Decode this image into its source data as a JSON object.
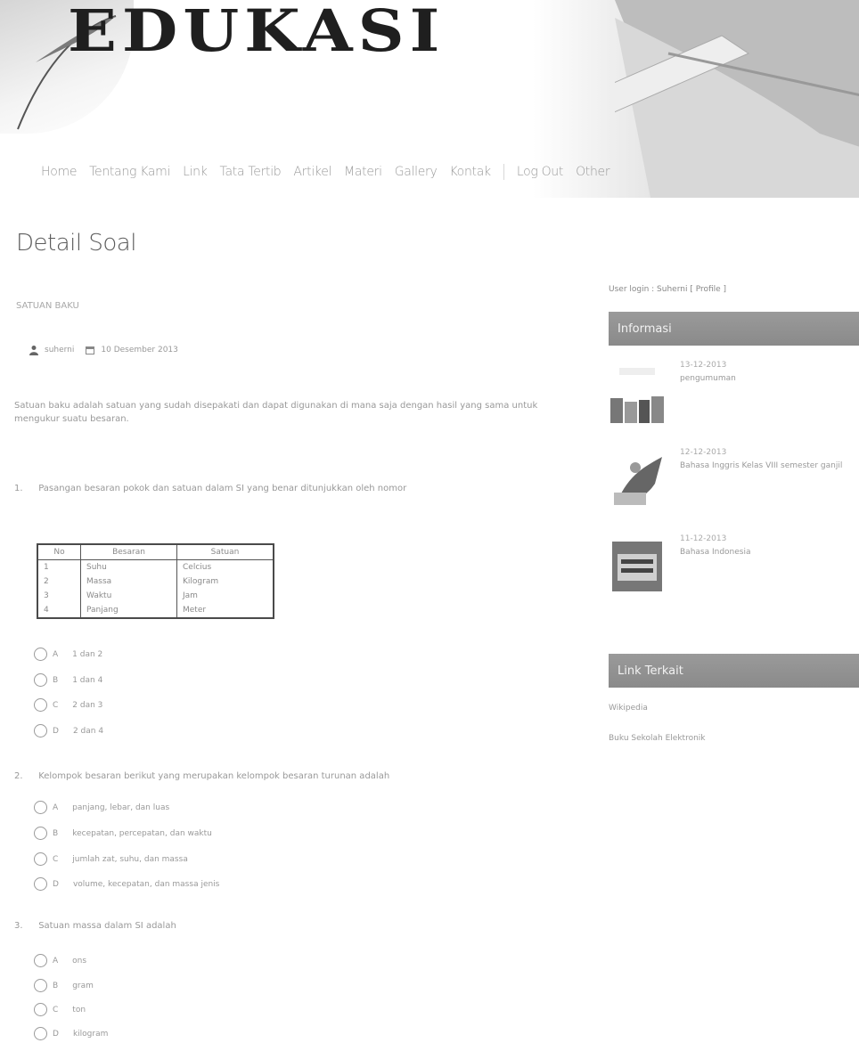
{
  "site": {
    "logo_text": "EDUKASI"
  },
  "nav": [
    "Home",
    "Tentang Kami",
    "Link",
    "Tata Tertib",
    "Artikel",
    "Materi",
    "Gallery",
    "Kontak",
    "Log Out",
    "Other"
  ],
  "page": {
    "title": "Detail Soal",
    "subtitle": "SATUAN BAKU",
    "author": "suherni",
    "date": "10 Desember 2013",
    "description": "Satuan baku adalah satuan yang sudah disepakati dan dapat digunakan di mana saja dengan hasil yang sama untuk mengukur suatu besaran."
  },
  "questions": [
    {
      "number": "1.",
      "text": "Pasangan besaran pokok dan satuan dalam SI yang benar ditunjukkan oleh nomor",
      "table": {
        "headers": [
          "No",
          "Besaran",
          "Satuan"
        ],
        "rows": [
          [
            "1",
            "Suhu",
            "Celcius"
          ],
          [
            "2",
            "Massa",
            "Kilogram"
          ],
          [
            "3",
            "Waktu",
            "Jam"
          ],
          [
            "4",
            "Panjang",
            "Meter"
          ]
        ]
      },
      "options": [
        {
          "label": "A",
          "text": "1 dan 2"
        },
        {
          "label": "B",
          "text": "1 dan 4"
        },
        {
          "label": "C",
          "text": "2 dan 3"
        },
        {
          "label": "D",
          "text": "2 dan 4"
        }
      ]
    },
    {
      "number": "2.",
      "text": "Kelompok besaran berikut yang merupakan kelompok besaran turunan adalah",
      "options": [
        {
          "label": "A",
          "text": "panjang, lebar, dan luas"
        },
        {
          "label": "B",
          "text": "kecepatan, percepatan, dan waktu"
        },
        {
          "label": "C",
          "text": "jumlah zat, suhu, dan massa"
        },
        {
          "label": "D",
          "text": "volume, kecepatan, dan massa jenis"
        }
      ]
    },
    {
      "number": "3.",
      "text": "Satuan massa dalam SI adalah",
      "options": [
        {
          "label": "A",
          "text": "ons"
        },
        {
          "label": "B",
          "text": "gram"
        },
        {
          "label": "C",
          "text": "ton"
        },
        {
          "label": "D",
          "text": "kilogram"
        }
      ]
    }
  ],
  "sidebar": {
    "user_login": "User login : Suherni [ Profile ]",
    "info_header": "Informasi",
    "info_items": [
      {
        "date": "13-12-2013",
        "title": "pengumuman"
      },
      {
        "date": "12-12-2013",
        "title": "Bahasa Inggris Kelas VIII semester ganjil"
      },
      {
        "date": "11-12-2013",
        "title": "Bahasa Indonesia"
      }
    ],
    "link_header": "Link Terkait",
    "links": [
      "Wikipedia",
      "Buku Sekolah Elektronik"
    ]
  },
  "colors": {
    "sidebar_header": "#8f8f8f",
    "text": "#999999",
    "title": "#5c5c5c"
  }
}
